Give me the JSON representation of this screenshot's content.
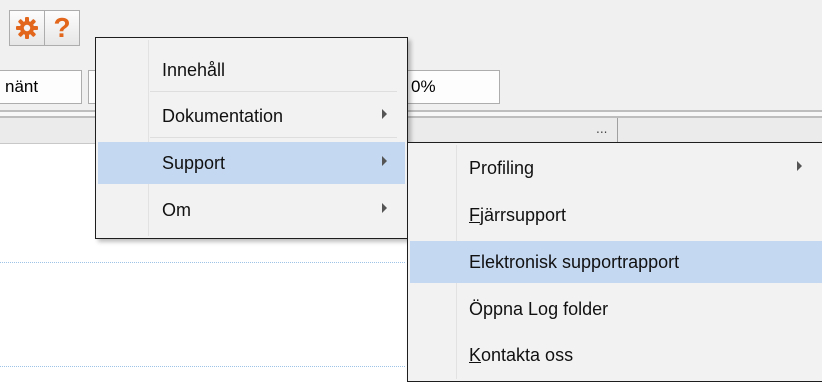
{
  "colors": {
    "menu_bg": "#f2f2f2",
    "highlight": "#c5d8f1",
    "gear_orange": "#e2661b",
    "help_orange": "#e2661b"
  },
  "toolbar": {
    "icons": [
      "gear-icon",
      "help-icon"
    ],
    "help_glyph": "?",
    "field_left": "nänt",
    "field_right": "0%",
    "ellipsis": "..."
  },
  "menu": {
    "items": [
      {
        "label": "Innehåll",
        "submenu": false
      },
      {
        "label": "Dokumentation",
        "submenu": true
      },
      {
        "label": "Support",
        "submenu": true,
        "highlighted": true
      },
      {
        "label": "Om",
        "submenu": true
      }
    ]
  },
  "submenu": {
    "items": [
      {
        "label": "Profiling",
        "submenu": true
      },
      {
        "label_prefix": "",
        "label_mnemonic": "F",
        "label_rest": "järrsupport"
      },
      {
        "label": "Elektronisk supportrapport",
        "highlighted": true
      },
      {
        "label": "Öppna Log folder"
      },
      {
        "label_prefix": "",
        "label_mnemonic": "K",
        "label_rest": "ontakta oss"
      }
    ]
  }
}
